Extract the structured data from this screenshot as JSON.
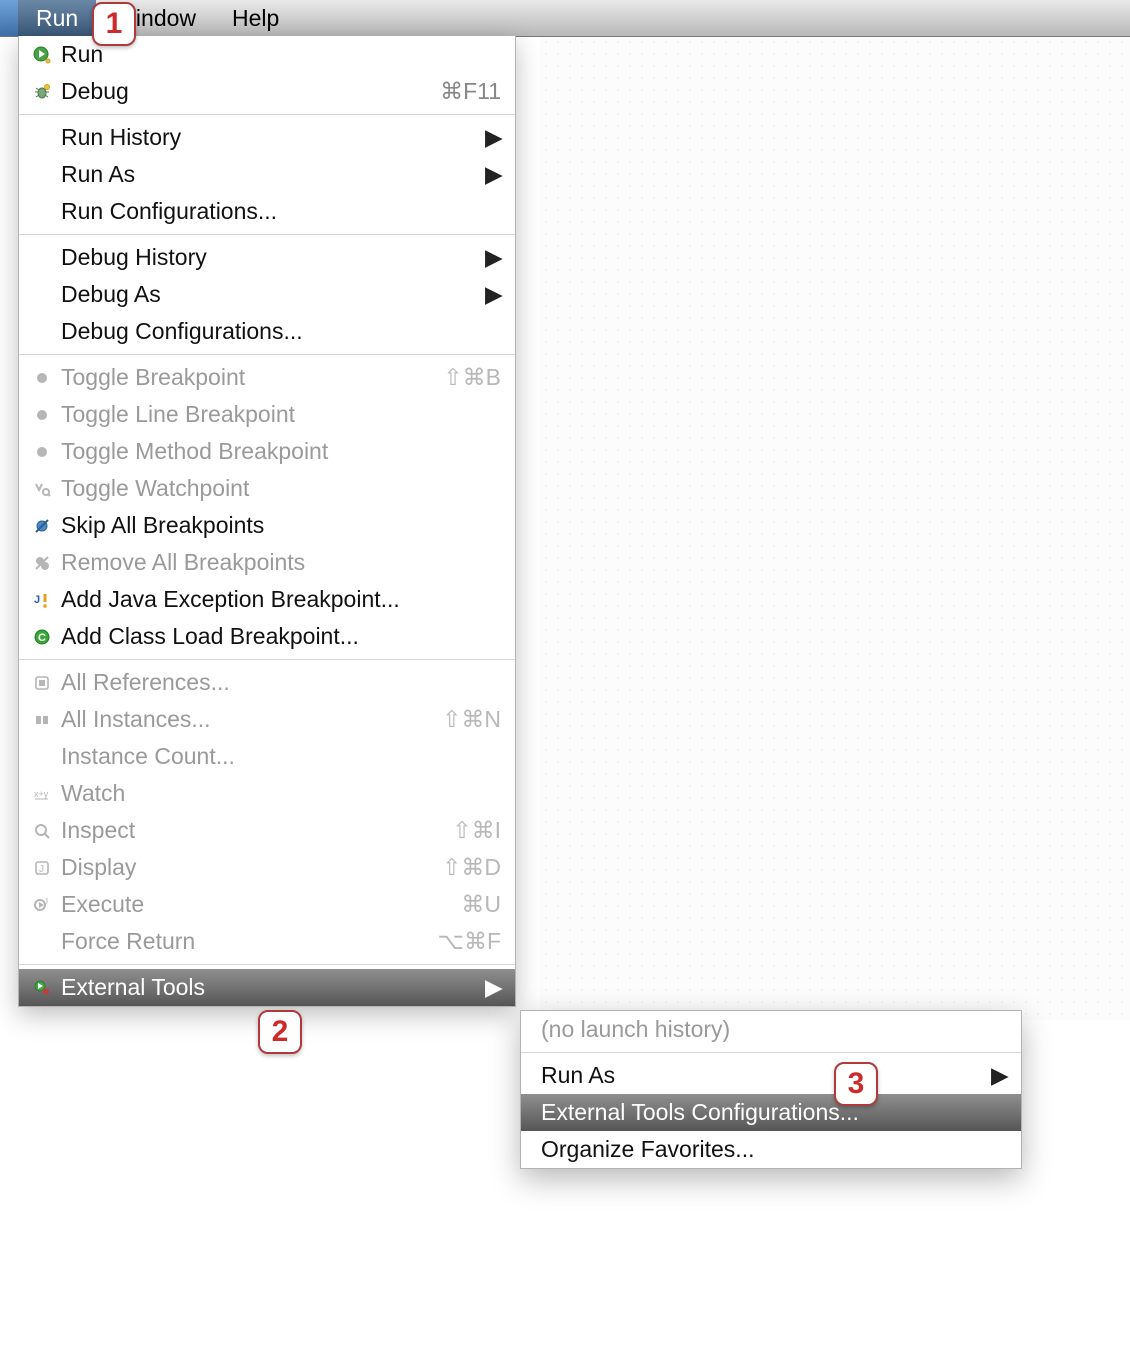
{
  "menubar": {
    "items": [
      {
        "label": "Run",
        "active": true
      },
      {
        "label": "Window"
      },
      {
        "label": "Help"
      }
    ]
  },
  "menu": {
    "groups": [
      [
        {
          "icon": "run-icon",
          "label": "Run",
          "accel": "",
          "submenu": false,
          "enabled": true
        },
        {
          "icon": "debug-icon",
          "label": "Debug",
          "accel": "⌘F11",
          "submenu": false,
          "enabled": true
        }
      ],
      [
        {
          "icon": "",
          "label": "Run History",
          "accel": "",
          "submenu": true,
          "enabled": true
        },
        {
          "icon": "",
          "label": "Run As",
          "accel": "",
          "submenu": true,
          "enabled": true
        },
        {
          "icon": "",
          "label": "Run Configurations...",
          "accel": "",
          "submenu": false,
          "enabled": true
        }
      ],
      [
        {
          "icon": "",
          "label": "Debug History",
          "accel": "",
          "submenu": true,
          "enabled": true
        },
        {
          "icon": "",
          "label": "Debug As",
          "accel": "",
          "submenu": true,
          "enabled": true
        },
        {
          "icon": "",
          "label": "Debug Configurations...",
          "accel": "",
          "submenu": false,
          "enabled": true
        }
      ],
      [
        {
          "icon": "breakpoint-icon",
          "label": "Toggle Breakpoint",
          "accel": "⇧⌘B",
          "submenu": false,
          "enabled": false
        },
        {
          "icon": "breakpoint-icon",
          "label": "Toggle Line Breakpoint",
          "accel": "",
          "submenu": false,
          "enabled": false
        },
        {
          "icon": "breakpoint-icon",
          "label": "Toggle Method Breakpoint",
          "accel": "",
          "submenu": false,
          "enabled": false
        },
        {
          "icon": "watchpoint-icon",
          "label": "Toggle Watchpoint",
          "accel": "",
          "submenu": false,
          "enabled": false
        },
        {
          "icon": "skip-bp-icon",
          "label": "Skip All Breakpoints",
          "accel": "",
          "submenu": false,
          "enabled": true
        },
        {
          "icon": "remove-bp-icon",
          "label": "Remove All Breakpoints",
          "accel": "",
          "submenu": false,
          "enabled": false
        },
        {
          "icon": "java-exc-icon",
          "label": "Add Java Exception Breakpoint...",
          "accel": "",
          "submenu": false,
          "enabled": true
        },
        {
          "icon": "class-load-icon",
          "label": "Add Class Load Breakpoint...",
          "accel": "",
          "submenu": false,
          "enabled": true
        }
      ],
      [
        {
          "icon": "refs-icon",
          "label": "All References...",
          "accel": "",
          "submenu": false,
          "enabled": false
        },
        {
          "icon": "instances-icon",
          "label": "All Instances...",
          "accel": "⇧⌘N",
          "submenu": false,
          "enabled": false
        },
        {
          "icon": "",
          "label": "Instance Count...",
          "accel": "",
          "submenu": false,
          "enabled": false
        },
        {
          "icon": "watch-icon",
          "label": "Watch",
          "accel": "",
          "submenu": false,
          "enabled": false
        },
        {
          "icon": "inspect-icon",
          "label": "Inspect",
          "accel": "⇧⌘I",
          "submenu": false,
          "enabled": false
        },
        {
          "icon": "display-icon",
          "label": "Display",
          "accel": "⇧⌘D",
          "submenu": false,
          "enabled": false
        },
        {
          "icon": "execute-icon",
          "label": "Execute",
          "accel": "⌘U",
          "submenu": false,
          "enabled": false
        },
        {
          "icon": "",
          "label": "Force Return",
          "accel": "⌥⌘F",
          "submenu": false,
          "enabled": false
        }
      ],
      [
        {
          "icon": "ext-tools-icon",
          "label": "External Tools",
          "accel": "",
          "submenu": true,
          "enabled": true,
          "selected": true
        }
      ]
    ]
  },
  "submenu": {
    "items": [
      {
        "label": "(no launch history)",
        "enabled": false
      },
      {
        "sep": true
      },
      {
        "label": "Run As",
        "submenu": true,
        "enabled": true
      },
      {
        "label": "External Tools Configurations...",
        "enabled": true,
        "selected": true
      },
      {
        "label": "Organize Favorites...",
        "enabled": true
      }
    ]
  },
  "badges": {
    "b1": "1",
    "b2": "2",
    "b3": "3"
  }
}
